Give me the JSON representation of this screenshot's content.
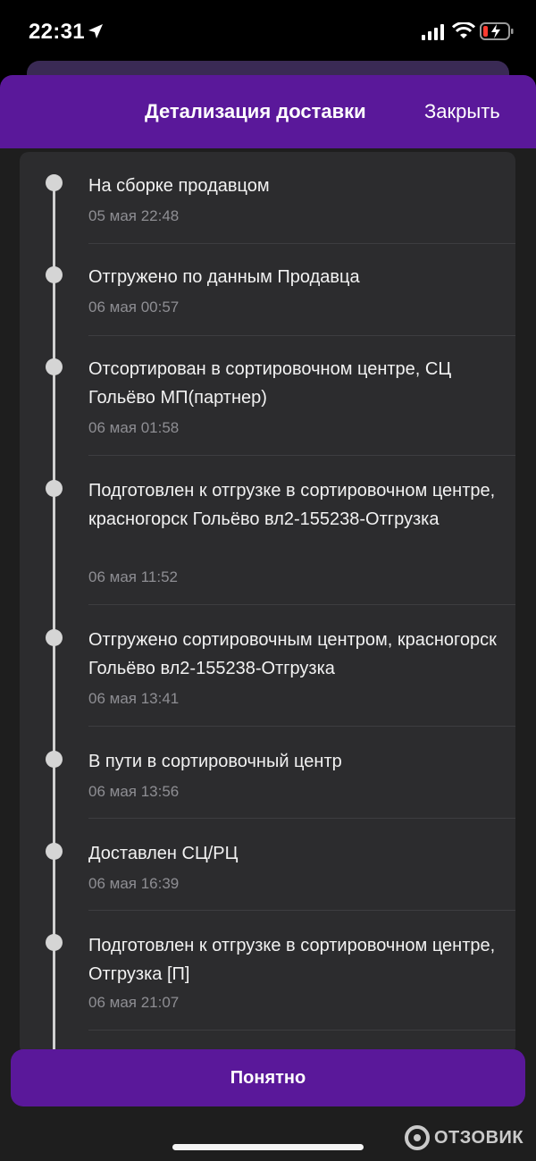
{
  "status_bar": {
    "time": "22:31"
  },
  "header": {
    "title": "Детализация доставки",
    "close_label": "Закрыть"
  },
  "events": [
    {
      "title": "На сборке продавцом",
      "date": "05 мая 22:48"
    },
    {
      "title": "Отгружено по данным Продавца",
      "date": "06 мая 00:57"
    },
    {
      "title": "Отсортирован в сортировочном центре, СЦ Гольёво МП(партнер)",
      "date": "06 мая 01:58"
    },
    {
      "title": "Подготовлен к отгрузке в сортировочном центре, красногорск Гольёво вл2-155238-Отгрузка",
      "date": "06 мая 11:52"
    },
    {
      "title": "Отгружено сортировочным центром, красногорск Гольёво вл2-155238-Отгрузка",
      "date": "06 мая 13:41"
    },
    {
      "title": "В пути в сортировочный центр",
      "date": "06 мая 13:56"
    },
    {
      "title": "Доставлен СЦ/РЦ",
      "date": "06 мая 16:39"
    },
    {
      "title": "Подготовлен к отгрузке в сортировочном центре, Отгрузка [П]",
      "date": "06 мая 21:07"
    }
  ],
  "button": {
    "label": "Понятно"
  },
  "watermark": {
    "text": "ОТЗОВИК"
  },
  "colors": {
    "accent": "#5a189a",
    "background": "#1e1e1e",
    "card": "#2c2c2e",
    "secondary_text": "#8e8e93"
  }
}
